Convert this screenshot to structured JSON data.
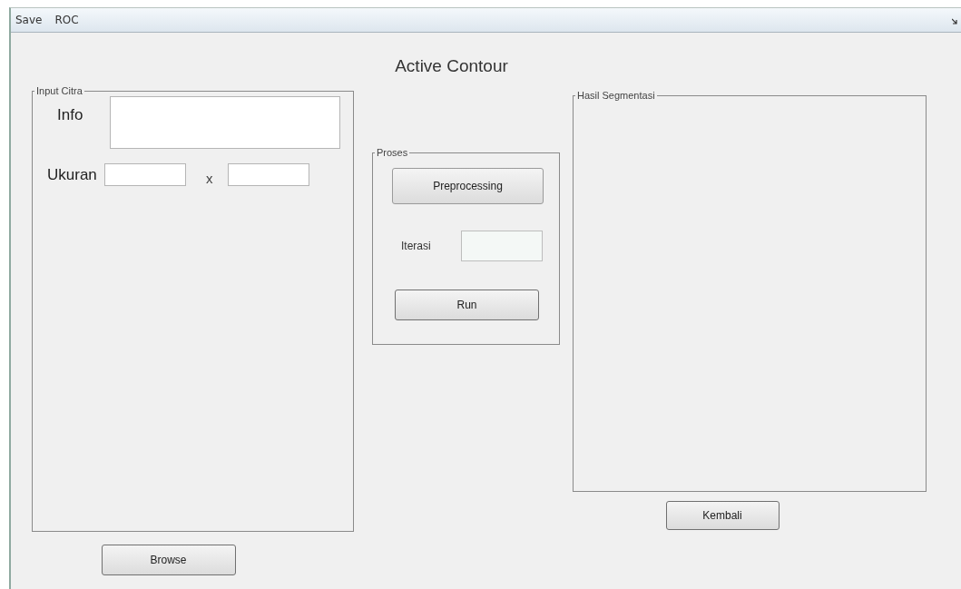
{
  "menu": [
    {
      "label": "Save"
    },
    {
      "label": "ROC"
    }
  ],
  "title": "Active Contour",
  "input_panel": {
    "title": "Input Citra",
    "info_label": "Info",
    "size_label": "Ukuran",
    "size_separator": "x"
  },
  "browse_button": "Browse",
  "process_panel": {
    "title": "Proses",
    "preprocess_button": "Preprocessing",
    "iteration_label": "Iterasi",
    "run_button": "Run"
  },
  "result_panel": {
    "title": "Hasil Segmentasi"
  },
  "back_button": "Kembali"
}
